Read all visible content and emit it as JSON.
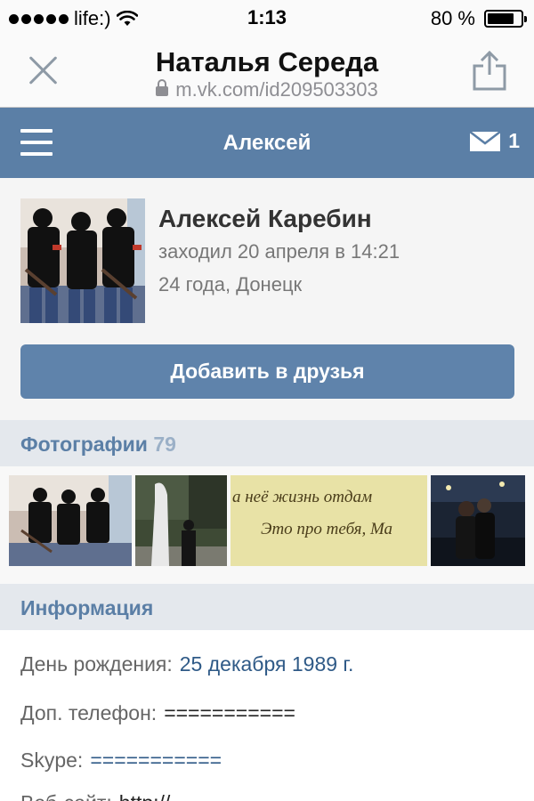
{
  "status_bar": {
    "carrier": "life:)",
    "time": "1:13",
    "battery_text": "80 %",
    "battery_level": 0.8,
    "signal_dots": 5
  },
  "browser": {
    "title": "Наталья Середа",
    "url": "m.vk.com/id209503303",
    "close_icon": "close-icon",
    "share_icon": "share-icon"
  },
  "vk_header": {
    "title": "Алексей",
    "messages_count": "1",
    "accent": "#5b7fa6"
  },
  "profile": {
    "name": "Алексей Каребин",
    "last_seen": "заходил 20 апреля в 14:21",
    "age_location": "24 года, Донецк",
    "add_button": "Добавить в друзья"
  },
  "photos": {
    "title": "Фотографии",
    "count": "79",
    "thumb3_line1": "а неё жизнь отдам",
    "thumb3_line2": "Это про тебя, Ма"
  },
  "info": {
    "title": "Информация",
    "rows": [
      {
        "label": "День рождения:",
        "value": "25 декабря 1989 г."
      },
      {
        "label": "Доп. телефон:",
        "value": "==========="
      },
      {
        "label": "Skype:",
        "value": "==========="
      },
      {
        "label": "Веб-сайт:",
        "value": "http://"
      }
    ]
  }
}
